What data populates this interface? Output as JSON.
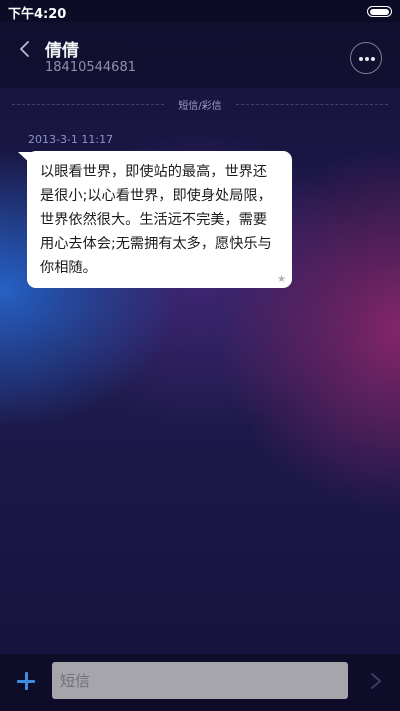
{
  "status_bar": {
    "time": "下午4:20",
    "battery_icon": "battery-full-icon"
  },
  "header": {
    "back_icon": "chevron-left-icon",
    "contact_name": "倩倩",
    "contact_number": "18410544681",
    "more_icon": "more-horizontal-icon"
  },
  "divider": {
    "label": "短信/彩信"
  },
  "messages": [
    {
      "timestamp": "2013-3-1 11:17",
      "text": "以眼看世界，即使站的最高，世界还是很小;以心看世界，即使身处局限，世界依然很大。生活远不完美，需要用心去体会;无需拥有太多，愿快乐与你相随。",
      "starred_icon": "star-icon"
    }
  ],
  "composer": {
    "add_icon": "plus-icon",
    "input_placeholder": "短信",
    "input_value": "",
    "send_icon": "send-chevron-icon"
  },
  "colors": {
    "accent": "#3f8be0",
    "bubble_bg": "#ffffff",
    "background_top": "#14123a",
    "glow_left": "#286edc",
    "glow_right": "#96286e"
  }
}
